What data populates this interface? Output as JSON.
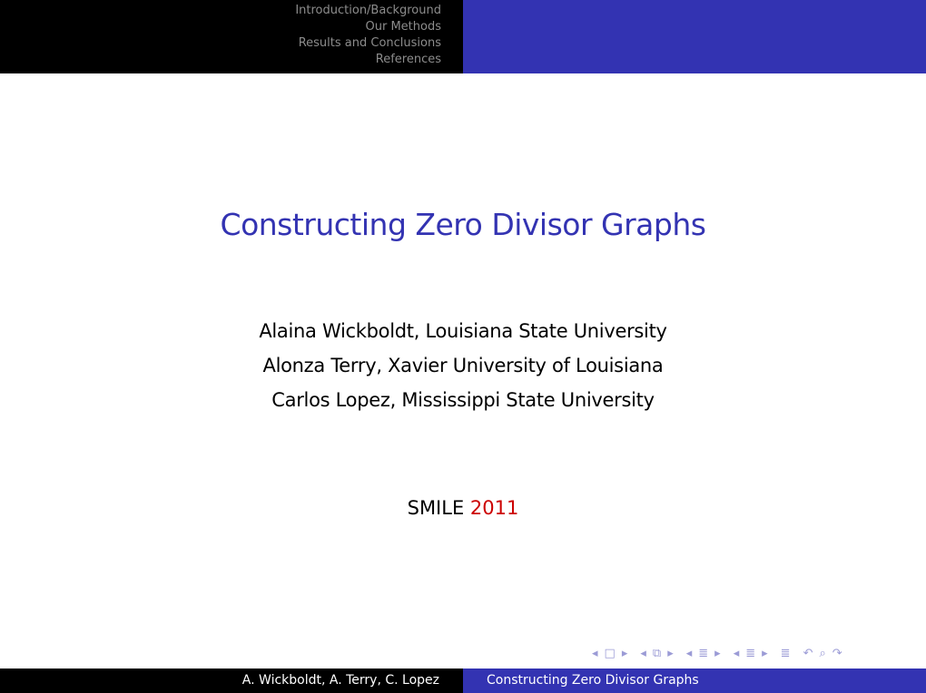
{
  "header": {
    "nav_items": [
      {
        "label": "Introduction/Background"
      },
      {
        "label": "Our Methods"
      },
      {
        "label": "Results and Conclusions"
      },
      {
        "label": "References"
      }
    ]
  },
  "slide": {
    "title": "Constructing Zero Divisor Graphs",
    "authors": [
      "Alaina Wickboldt, Louisiana State University",
      "Alonza Terry, Xavier University of Louisiana",
      "Carlos Lopez, Mississippi State University"
    ],
    "event_name": "SMILE",
    "event_year": "2011"
  },
  "navigation_symbols": {
    "frame_prev": "◂",
    "frame_icon": "□",
    "frame_next": "▸",
    "subsection_prev": "◂",
    "subsection_icon": "⧉",
    "subsection_next": "▸",
    "section_prev": "◂",
    "section_icon": "≣",
    "section_next": "▸",
    "presentation_prev": "◂",
    "presentation_icon": "≣",
    "presentation_next": "▸",
    "appendix_icon": "≣",
    "back_icon": "↶",
    "search_icon": "⌕",
    "forward_icon": "↷"
  },
  "footer": {
    "authors_short": "A. Wickboldt, A. Terry, C. Lopez",
    "title_short": "Constructing Zero Divisor Graphs"
  },
  "colors": {
    "accent": "#3333b2",
    "alert": "#cc0000",
    "header_bg": "#000000"
  }
}
